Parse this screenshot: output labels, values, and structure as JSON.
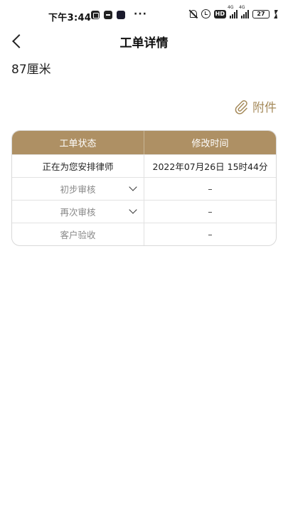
{
  "status_bar": {
    "time": "下午3:44",
    "dots": "···",
    "hd": "HD",
    "signal1_label": "4G",
    "signal2_label": "4G",
    "battery": "27",
    "battery_color": "#47c45f"
  },
  "nav": {
    "title": "工单详情"
  },
  "measurement": "87厘米",
  "attachment": {
    "label": "附件",
    "color": "#a58a5a"
  },
  "table": {
    "header_color": "#ae9064",
    "headers": [
      "工单状态",
      "修改时间"
    ],
    "rows": [
      {
        "status": "正在为您安排律师",
        "time": "2022年07月26日 15时44分"
      },
      {
        "status": "初步审核",
        "time": "–"
      },
      {
        "status": "再次审核",
        "time": "–"
      },
      {
        "status": "客户验收",
        "time": "–"
      }
    ]
  }
}
